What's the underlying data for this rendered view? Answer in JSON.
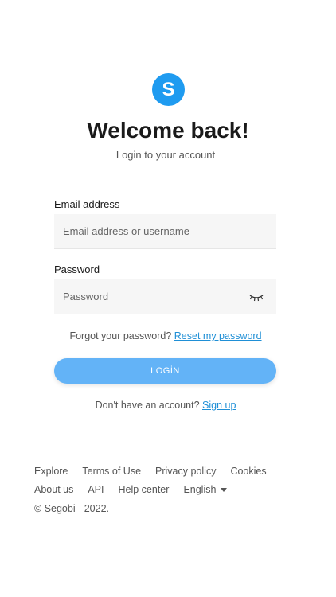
{
  "brand": {
    "logo_letter": "S",
    "color": "#1f9bf0"
  },
  "header": {
    "title": "Welcome back!",
    "subtitle": "Login to your account"
  },
  "form": {
    "email_label": "Email address",
    "email_placeholder": "Email address or username",
    "password_label": "Password",
    "password_placeholder": "Password",
    "show_password_icon": "eye-closed-icon",
    "forgot_text": "Forgot your password?",
    "reset_link": "Reset my password",
    "login_label": "LOGİN",
    "signup_text": "Don't have an account?",
    "signup_link": "Sign up"
  },
  "footer": {
    "links_row1": [
      "Explore",
      "Terms of Use",
      "Privacy policy",
      "Cookies"
    ],
    "links_row2": [
      "About us",
      "API",
      "Help center"
    ],
    "language": "English",
    "copyright": "© Segobi - 2022."
  }
}
